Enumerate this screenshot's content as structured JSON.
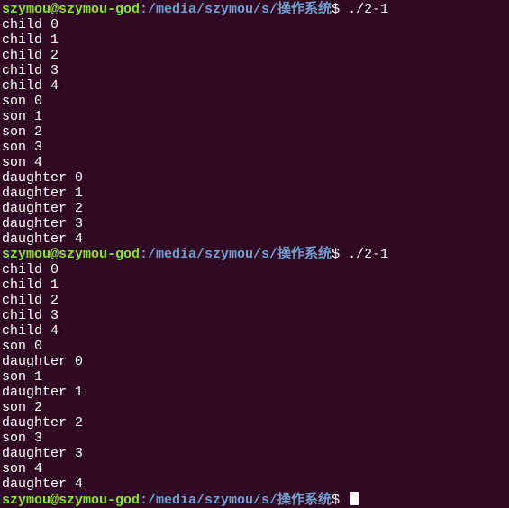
{
  "terminal": {
    "colors": {
      "background": "#300a24",
      "user": "#8ae234",
      "path": "#729fcf",
      "text": "#ffffff"
    },
    "prompt": {
      "user_host": "szymou@szymou-god",
      "path": ":/media/szymou/s/操作系统",
      "symbol": "$"
    },
    "lines": [
      {
        "type": "prompt",
        "command": " ./2-1"
      },
      {
        "type": "output",
        "text": "child 0"
      },
      {
        "type": "output",
        "text": "child 1"
      },
      {
        "type": "output",
        "text": "child 2"
      },
      {
        "type": "output",
        "text": "child 3"
      },
      {
        "type": "output",
        "text": "child 4"
      },
      {
        "type": "output",
        "text": "son 0"
      },
      {
        "type": "output",
        "text": "son 1"
      },
      {
        "type": "output",
        "text": "son 2"
      },
      {
        "type": "output",
        "text": "son 3"
      },
      {
        "type": "output",
        "text": "son 4"
      },
      {
        "type": "output",
        "text": "daughter 0"
      },
      {
        "type": "output",
        "text": "daughter 1"
      },
      {
        "type": "output",
        "text": "daughter 2"
      },
      {
        "type": "output",
        "text": "daughter 3"
      },
      {
        "type": "output",
        "text": "daughter 4"
      },
      {
        "type": "prompt",
        "command": " ./2-1"
      },
      {
        "type": "output",
        "text": "child 0"
      },
      {
        "type": "output",
        "text": "child 1"
      },
      {
        "type": "output",
        "text": "child 2"
      },
      {
        "type": "output",
        "text": "child 3"
      },
      {
        "type": "output",
        "text": "child 4"
      },
      {
        "type": "output",
        "text": "son 0"
      },
      {
        "type": "output",
        "text": "daughter 0"
      },
      {
        "type": "output",
        "text": "son 1"
      },
      {
        "type": "output",
        "text": "daughter 1"
      },
      {
        "type": "output",
        "text": "son 2"
      },
      {
        "type": "output",
        "text": "daughter 2"
      },
      {
        "type": "output",
        "text": "son 3"
      },
      {
        "type": "output",
        "text": "daughter 3"
      },
      {
        "type": "output",
        "text": "son 4"
      },
      {
        "type": "output",
        "text": "daughter 4"
      },
      {
        "type": "prompt",
        "command": " ",
        "cursor": true
      }
    ]
  }
}
